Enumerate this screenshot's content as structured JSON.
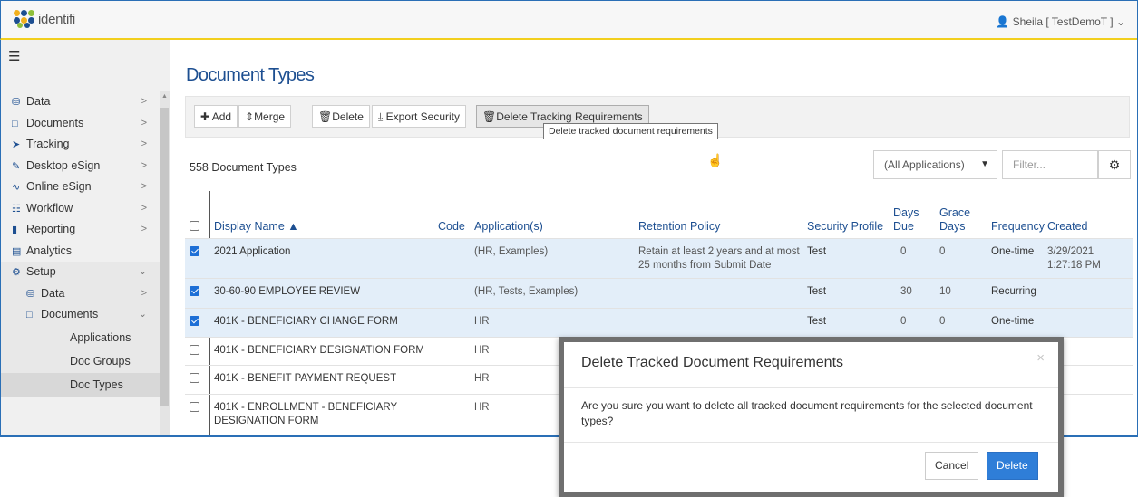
{
  "app": {
    "logo_text": "identifi",
    "user_menu": "Sheila [ TestDemoT ]",
    "colors": {
      "brand_blue": "#1d4f91",
      "accent_yellow": "#f2cf1e",
      "selected_row": "#e3eef9",
      "primary_button": "#2f7ed8"
    }
  },
  "sidebar": {
    "items": [
      {
        "label": "Data",
        "icon": "database-icon"
      },
      {
        "label": "Documents",
        "icon": "clipboard-icon"
      },
      {
        "label": "Tracking",
        "icon": "send-icon"
      },
      {
        "label": "Desktop eSign",
        "icon": "pen-icon"
      },
      {
        "label": "Online eSign",
        "icon": "signature-icon"
      },
      {
        "label": "Workflow",
        "icon": "sitemap-icon"
      },
      {
        "label": "Reporting",
        "icon": "file-icon"
      },
      {
        "label": "Analytics",
        "icon": "chart-icon"
      },
      {
        "label": "Setup",
        "icon": "gear-icon"
      }
    ],
    "setup_children": [
      {
        "label": "Data",
        "icon": "database-icon"
      },
      {
        "label": "Documents",
        "icon": "clipboard-icon"
      }
    ],
    "documents_children": [
      "Applications",
      "Doc Groups",
      "Doc Types"
    ]
  },
  "page": {
    "title": "Document Types",
    "toolbar": {
      "add": "Add",
      "merge": "Merge",
      "delete": "Delete",
      "export_security": "Export Security",
      "delete_tracking": "Delete Tracking Requirements"
    },
    "tooltip": "Delete tracked document requirements",
    "count": "558 Document Types",
    "app_filter": "(All Applications)",
    "filter_placeholder": "Filter..."
  },
  "grid": {
    "headers": {
      "display_name": "Display Name",
      "code": "Code",
      "applications": "Application(s)",
      "retention": "Retention Policy",
      "security": "Security Profile",
      "days_due": "Days Due",
      "grace_days": "Grace Days",
      "frequency": "Frequency",
      "created": "Created"
    },
    "rows": [
      {
        "checked": true,
        "name": "2021 Application",
        "apps": "(HR, Examples)",
        "retention": "Retain at least 2 years and at most 25 months from Submit Date",
        "security": "Test",
        "days_due": "0",
        "grace": "0",
        "frequency": "One-time",
        "created": "3/29/2021 1:27:18 PM"
      },
      {
        "checked": true,
        "name": "30-60-90 EMPLOYEE REVIEW",
        "apps": "(HR, Tests, Examples)",
        "retention": "",
        "security": "Test",
        "days_due": "30",
        "grace": "10",
        "frequency": "Recurring",
        "created": ""
      },
      {
        "checked": true,
        "name": "401K - BENEFICIARY CHANGE FORM",
        "apps": "HR",
        "retention": "",
        "security": "Test",
        "days_due": "0",
        "grace": "0",
        "frequency": "One-time",
        "created": ""
      },
      {
        "checked": false,
        "name": "401K - BENEFICIARY DESIGNATION FORM",
        "apps": "HR",
        "retention": "",
        "security": "",
        "days_due": "",
        "grace": "",
        "frequency": "",
        "created": ""
      },
      {
        "checked": false,
        "name": "401K - BENEFIT PAYMENT REQUEST",
        "apps": "HR",
        "retention": "",
        "security": "",
        "days_due": "",
        "grace": "",
        "frequency": "",
        "created": ""
      },
      {
        "checked": false,
        "name": "401K - ENROLLMENT - BENEFICIARY DESIGNATION FORM",
        "apps": "HR",
        "retention": "",
        "security": "",
        "days_due": "",
        "grace": "",
        "frequency": "",
        "created": ""
      }
    ]
  },
  "modal": {
    "title": "Delete Tracked Document Requirements",
    "body": "Are you sure you want to delete all tracked document requirements for the selected document types?",
    "cancel": "Cancel",
    "confirm": "Delete"
  }
}
